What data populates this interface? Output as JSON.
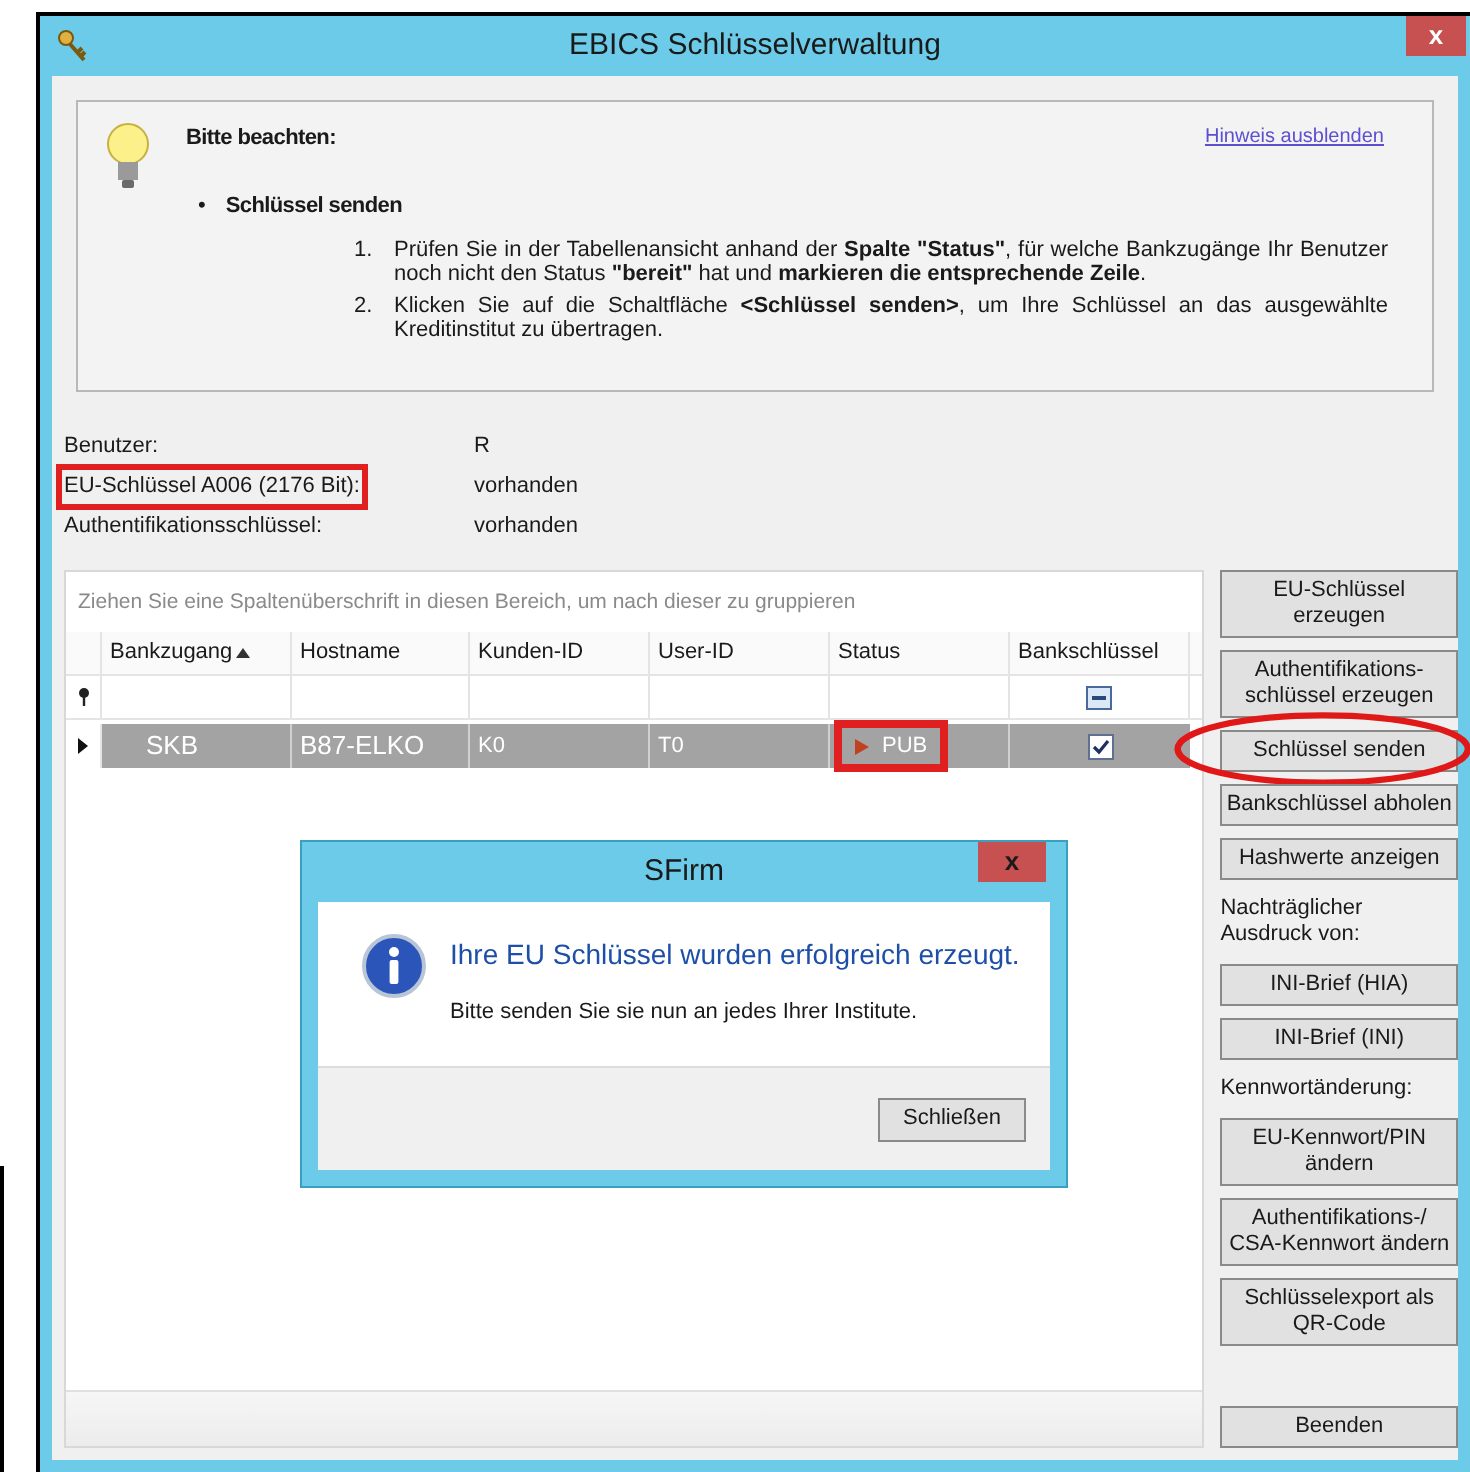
{
  "window": {
    "title": "EBICS Schlüsselverwaltung",
    "close": "x"
  },
  "notice": {
    "heading": "Bitte beachten:",
    "link": "Hinweis ausblenden",
    "bullet": "•",
    "section": "Schlüssel senden",
    "steps": [
      {
        "number": "1.",
        "text": "Prüfen Sie in der Tabellenansicht anhand der **Spalte \"Status\"**, für welche Bankzugänge Ihr Benutzer noch nicht den Status **\"bereit\"** hat und **markieren die entsprechende Zeile**."
      },
      {
        "number": "2.",
        "text": "Klicken Sie auf die Schaltfläche **<Schlüssel senden>**, um Ihre Schlüssel an das ausgewählte Kreditinstitut zu übertragen."
      }
    ]
  },
  "info": [
    {
      "label": "Benutzer:",
      "value": "R",
      "marked": false
    },
    {
      "label": "EU-Schlüssel A006 (2176 Bit):",
      "value": "vorhanden",
      "marked": true
    },
    {
      "label": "Authentifikationsschlüssel:",
      "value": "vorhanden",
      "marked": false
    }
  ],
  "grid": {
    "group_hint": "Ziehen Sie eine Spaltenüberschrift in diesen Bereich, um nach dieser zu gruppieren",
    "columns": [
      {
        "label": "Bankzugang",
        "sorted": true
      },
      {
        "label": "Hostname",
        "sorted": false
      },
      {
        "label": "Kunden-ID",
        "sorted": false
      },
      {
        "label": "User-ID",
        "sorted": false
      },
      {
        "label": "Status",
        "sorted": false
      },
      {
        "label": "Bankschlüssel",
        "sorted": false
      }
    ],
    "rows": [
      {
        "selected": true,
        "bankzugang": "SKB",
        "hostname": "B87-ELKO",
        "kunden_id": "K0",
        "user_id": "T0",
        "status": "PUB",
        "status_marked": true,
        "bankschluessel": true
      }
    ]
  },
  "side": [
    {
      "kind": "button",
      "label": "EU-Schlüssel erzeugen",
      "circled": false
    },
    {
      "kind": "button",
      "label": "Authentifikations-schlüssel erzeugen",
      "circled": false
    },
    {
      "kind": "button",
      "label": "Schlüssel senden",
      "circled": true
    },
    {
      "kind": "button",
      "label": "Bankschlüssel abholen",
      "circled": false
    },
    {
      "kind": "button",
      "label": "Hashwerte anzeigen",
      "circled": false
    },
    {
      "kind": "label",
      "label": "Nachträglicher Ausdruck von:"
    },
    {
      "kind": "button",
      "label": "INI-Brief (HIA)",
      "circled": false
    },
    {
      "kind": "button",
      "label": "INI-Brief (INI)",
      "circled": false
    },
    {
      "kind": "label",
      "label": "Kennwortänderung:"
    },
    {
      "kind": "button",
      "label": "EU-Kennwort/PIN ändern",
      "circled": false
    },
    {
      "kind": "button",
      "label": "Authentifikations-/ CSA-Kennwort ändern",
      "circled": false
    },
    {
      "kind": "button",
      "label": "Schlüsselexport als QR-Code",
      "circled": false
    },
    {
      "kind": "footer",
      "label": "Beenden",
      "circled": false
    }
  ],
  "dialog": {
    "title": "SFirm",
    "close": "x",
    "heading": "Ihre EU Schlüssel wurden erfolgreich erzeugt.",
    "message": "Bitte senden Sie sie nun an jedes Ihrer Institute.",
    "button": "Schließen"
  }
}
